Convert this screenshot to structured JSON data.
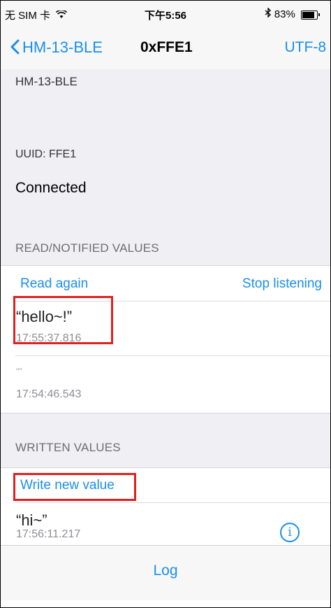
{
  "status_bar": {
    "carrier": "无 SIM 卡",
    "time": "下午5:56",
    "battery": "83%",
    "battery_level": 0.83
  },
  "nav": {
    "back_label": "HM-13-BLE",
    "title": "0xFFE1",
    "action_label": "UTF-8"
  },
  "peripheral": {
    "name": "HM-13-BLE",
    "uuid": "UUID: FFE1",
    "status": "Connected"
  },
  "read_section": {
    "header": "READ/NOTIFIED VALUES",
    "read_again": "Read again",
    "stop_listening": "Stop listening",
    "values": [
      {
        "value": "“hello~!”",
        "timestamp": "17:55:37.816"
      },
      {
        "value": "“”",
        "timestamp": "17:54:46.543"
      }
    ]
  },
  "written_section": {
    "header": "WRITTEN VALUES",
    "write_new": "Write new value",
    "values": [
      {
        "value": "“hi~”",
        "timestamp": "17:56:11.217"
      }
    ]
  },
  "tab": {
    "log": "Log"
  },
  "colors": {
    "accent": "#1a8ef0",
    "highlight": "#e02020"
  },
  "icons": [
    "wifi-icon",
    "bluetooth-icon",
    "battery-icon",
    "chevron-left-icon",
    "info-icon"
  ]
}
